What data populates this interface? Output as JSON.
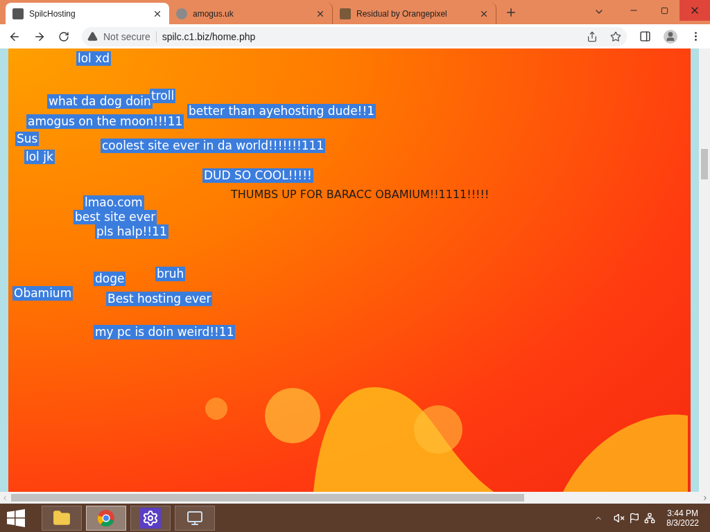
{
  "tabs": [
    {
      "title": "SpilcHosting",
      "selected": true
    },
    {
      "title": "amogus.uk",
      "selected": false
    },
    {
      "title": "Residual by Orangepixel",
      "selected": false
    }
  ],
  "address_bar": {
    "security": "Not secure",
    "url": "spilc.c1.biz/home.php"
  },
  "page": {
    "labels": [
      {
        "text": "lol xd",
        "kind": "tag"
      },
      {
        "text": "what da dog doin",
        "kind": "tag"
      },
      {
        "text": "troll",
        "kind": "tag"
      },
      {
        "text": "better than ayehosting dude!!1",
        "kind": "tag"
      },
      {
        "text": "amogus on the moon!!!11",
        "kind": "tag"
      },
      {
        "text": "Sus",
        "kind": "tag"
      },
      {
        "text": "coolest site ever in da world!!!!!!!111",
        "kind": "tag"
      },
      {
        "text": "lol jk",
        "kind": "tag"
      },
      {
        "text": "DUD SO COOL!!!!!",
        "kind": "tag"
      },
      {
        "text": "THUMBS UP FOR BARACC OBAMIUM!!1111!!!!!",
        "kind": "plain"
      },
      {
        "text": "lmao.com",
        "kind": "tag"
      },
      {
        "text": "best site ever",
        "kind": "tag"
      },
      {
        "text": "pls halp!!11",
        "kind": "tag"
      },
      {
        "text": "bruh",
        "kind": "tag"
      },
      {
        "text": "doge",
        "kind": "tag"
      },
      {
        "text": "Obamium",
        "kind": "tag"
      },
      {
        "text": "Best hosting ever",
        "kind": "tag"
      },
      {
        "text": "my pc is doin weird!!11",
        "kind": "tag"
      }
    ]
  },
  "taskbar": {
    "apps": [
      {
        "kind": "folder",
        "selected": false
      },
      {
        "kind": "browser",
        "selected": true
      },
      {
        "kind": "settings",
        "selected": false
      },
      {
        "kind": "monitor",
        "selected": false
      }
    ]
  },
  "clock": {
    "time": "3:44 PM",
    "date": "8/3/2022"
  }
}
